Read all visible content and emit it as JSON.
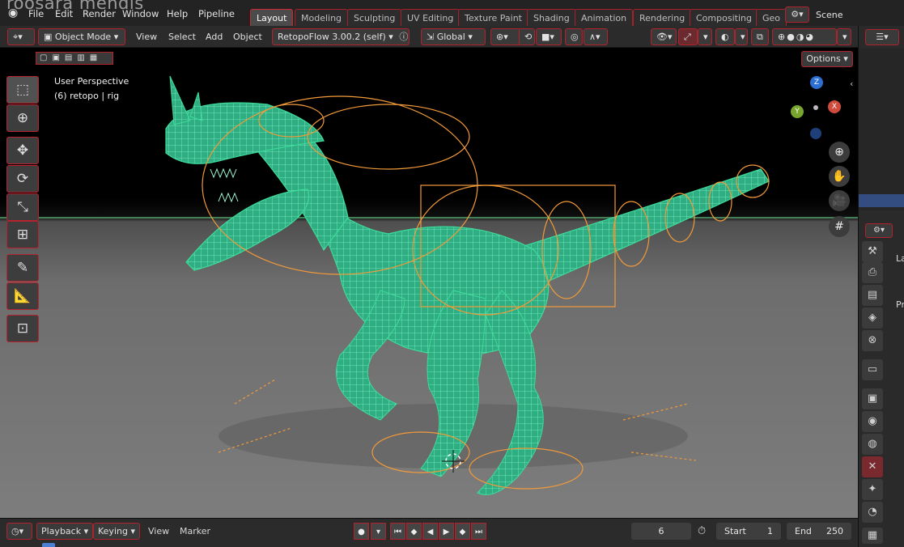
{
  "watermark": "roosara mendis",
  "topbar": {
    "menus": [
      "File",
      "Edit",
      "Render",
      "Window",
      "Help",
      "Pipeline"
    ],
    "workspaces": [
      {
        "label": "Layout",
        "active": true
      },
      {
        "label": "Modeling",
        "active": false
      },
      {
        "label": "Sculpting",
        "active": false
      },
      {
        "label": "UV Editing",
        "active": false
      },
      {
        "label": "Texture Paint",
        "active": false
      },
      {
        "label": "Shading",
        "active": false
      },
      {
        "label": "Animation",
        "active": false
      },
      {
        "label": "Rendering",
        "active": false
      },
      {
        "label": "Compositing",
        "active": false
      },
      {
        "label": "Geo",
        "active": false
      }
    ],
    "scene_label": "Scene"
  },
  "header": {
    "mode": "Object Mode",
    "menus": [
      "View",
      "Select",
      "Add",
      "Object"
    ],
    "addon": "RetopoFlow 3.00.2 (self)",
    "orientation": "Global",
    "options_label": "Options"
  },
  "viewport": {
    "perspective_label": "User Perspective",
    "object_label": "(6) retopo | rig",
    "gizmo_axes": {
      "z": "Z",
      "x": "X",
      "y": "Y"
    },
    "tools": [
      "select-box-icon",
      "cursor-icon",
      "move-icon",
      "rotate-icon",
      "scale-icon",
      "transform-icon",
      "annotate-icon",
      "measure-icon",
      "add-cube-icon"
    ],
    "nav_buttons": [
      "zoom-icon",
      "pan-hand-icon",
      "camera-icon",
      "grid-icon"
    ],
    "colors": {
      "mesh": "#3ddc9a",
      "rig": "#f29a3a",
      "accent": "#d0242f",
      "ground": "#6d6d6d"
    }
  },
  "timeline": {
    "playback_label": "Playback",
    "keying_label": "Keying",
    "view_label": "View",
    "marker_label": "Marker",
    "current_frame": "6",
    "start_label": "Start",
    "start_value": "1",
    "end_label": "End",
    "end_value": "250"
  },
  "right_panel": {
    "labels": [
      "La",
      "Pr"
    ],
    "icons": [
      "tool-icon",
      "render-icon",
      "output-icon",
      "view-layer-icon",
      "scene-icon",
      "world-icon",
      "collection-icon",
      "object-icon",
      "modifier-icon",
      "particles-icon",
      "physics-icon",
      "constraint-icon",
      "data-icon",
      "material-icon"
    ]
  }
}
